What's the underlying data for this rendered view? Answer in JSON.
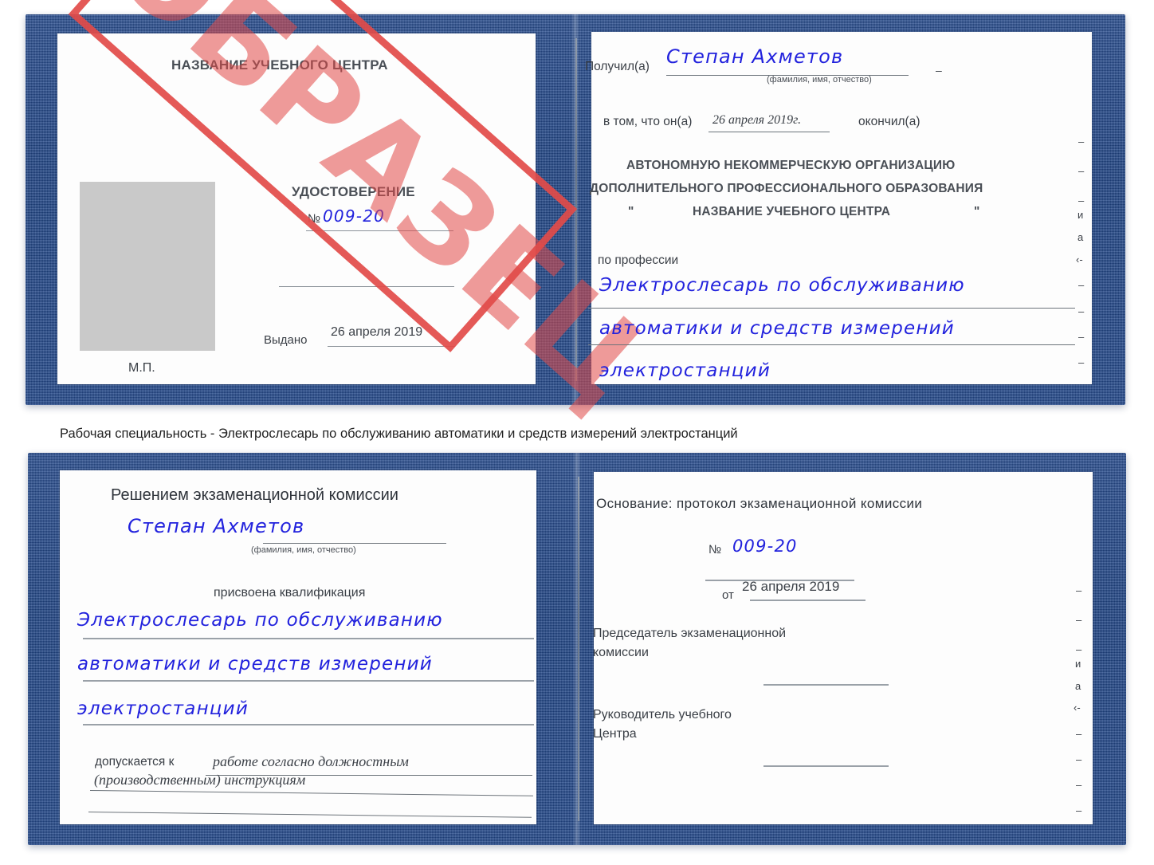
{
  "page": {
    "caption": "Рабочая специальность - Электрослесарь по обслуживанию автоматики и средств измерений электростанций"
  },
  "colors": {
    "cover_blue": "#23498c",
    "stamp_red": "#e24b49",
    "handwriting_blue": "#2222dd",
    "photo_gray": "#c9c9c9",
    "rule_gray": "#8b9299"
  },
  "stamp": {
    "text": "ОБРАЗЕЦ"
  },
  "certificate_front": {
    "left_page": {
      "center_name": "НАЗВАНИЕ УЧЕБНОГО ЦЕНТРА",
      "doc_title": "УДОСТОВЕРЕНИЕ",
      "number_label": "№",
      "number_value": "009-20",
      "issued_label": "Выдано",
      "issued_value": "26 апреля 2019",
      "seal_label": "М.П."
    },
    "right_page": {
      "received_label": "Получил(а)",
      "received_value": "Степан Ахметов",
      "fio_hint": "(фамилия, имя, отчество)",
      "in_that_label": "в том, что он(а)",
      "completion_date": "26 апреля 2019г.",
      "finished_label": "окончил(а)",
      "org_line1": "АВТОНОМНУЮ НЕКОММЕРЧЕСКУЮ ОРГАНИЗАЦИЮ",
      "org_line2": "ДОПОЛНИТЕЛЬНОГО ПРОФЕССИОНАЛЬНОГО ОБРАЗОВАНИЯ",
      "org_quote_open": "\"",
      "org_line3": "НАЗВАНИЕ УЧЕБНОГО ЦЕНТРА",
      "org_quote_close": "\"",
      "profession_label": "по профессии",
      "profession_line1": "Электрослесарь по обслуживанию",
      "profession_line2": "автоматики и средств измерений",
      "profession_line3": "электростанций",
      "edge_marks": [
        "–",
        "–",
        "–",
        "и",
        "а",
        "‹-",
        "–",
        "–",
        "–",
        "–"
      ]
    }
  },
  "certificate_back": {
    "left_page": {
      "heading": "Решением экзаменационной комиссии",
      "name_value": "Степан Ахметов",
      "fio_hint": "(фамилия, имя, отчество)",
      "qualification_label": "присвоена квалификация",
      "qualification_line1": "Электрослесарь по обслуживанию",
      "qualification_line2": "автоматики и средств измерений",
      "qualification_line3": "электростанций",
      "allowed_label": "допускается к",
      "allowed_value_line1": "работе согласно должностным",
      "allowed_value_line2": "(производственным) инструкциям"
    },
    "right_page": {
      "basis_label": "Основание: протокол экзаменационной комиссии",
      "number_label": "№",
      "number_value": "009-20",
      "date_label": "от",
      "date_value": "26 апреля 2019",
      "chairman_line1": "Председатель экзаменационной",
      "chairman_line2": "комиссии",
      "head_line1": "Руководитель учебного",
      "head_line2": "Центра",
      "edge_marks": [
        "–",
        "–",
        "–",
        "и",
        "а",
        "‹-",
        "–",
        "–",
        "–",
        "–"
      ]
    }
  }
}
